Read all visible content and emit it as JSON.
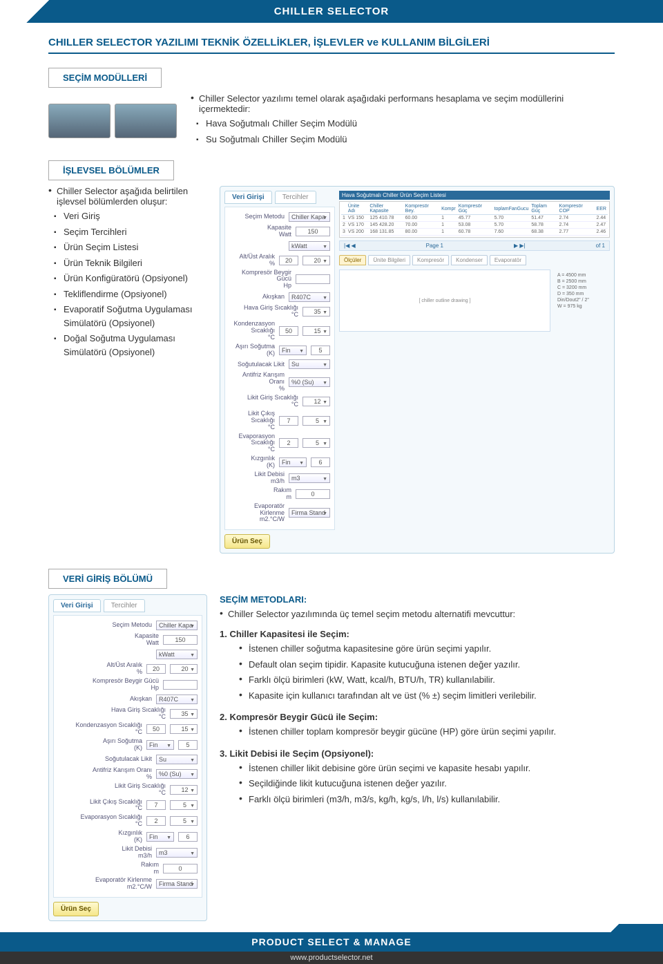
{
  "header": {
    "title": "CHILLER SELECTOR"
  },
  "subtitle": "CHILLER SELECTOR YAZILIMI TEKNİK ÖZELLİKLER, İŞLEVLER ve KULLANIM BİLGİLERİ",
  "section1": {
    "label": "SEÇİM MODÜLLERİ",
    "intro": "Chiller Selector yazılımı temel olarak aşağıdaki performans hesaplama ve seçim modüllerini içermektedir:",
    "items": [
      "Hava Soğutmalı Chiller Seçim Modülü",
      "Su Soğutmalı Chiller Seçim Modülü"
    ]
  },
  "section2": {
    "label": "İŞLEVSEL BÖLÜMLER",
    "intro": "Chiller Selector aşağıda belirtilen işlevsel bölümlerden oluşur:",
    "items": [
      "Veri Giriş",
      "Seçim Tercihleri",
      "Ürün Seçim Listesi",
      "Ürün Teknik Bilgileri",
      "Ürün Konfigüratörü (Opsiyonel)",
      "Tekliflendirme (Opsiyonel)",
      "Evaporatif Soğutma Uygulaması Simülatörü (Opsiyonel)",
      "Doğal Soğutma Uygulaması Simülatörü (Opsiyonel)"
    ]
  },
  "section3": {
    "label": "VERİ GİRİŞ BÖLÜMÜ"
  },
  "methods": {
    "title": "SEÇİM METODLARI:",
    "intro": "Chiller Selector yazılımında üç temel seçim metodu alternatifi mevcuttur:",
    "m1": {
      "title": "1. Chiller Kapasitesi ile Seçim:",
      "items": [
        "İstenen chiller soğutma kapasitesine göre ürün seçimi yapılır.",
        "Default olan seçim tipidir. Kapasite kutucuğuna istenen değer yazılır.",
        "Farklı ölçü birimleri (kW, Watt, kcal/h, BTU/h, TR) kullanılabilir.",
        "Kapasite için kullanıcı tarafından alt ve üst (% ±) seçim limitleri verilebilir."
      ]
    },
    "m2": {
      "title": "2. Kompresör Beygir Gücü ile Seçim:",
      "items": [
        "İstenen chiller toplam kompresör beygir gücüne (HP) göre ürün seçimi yapılır."
      ]
    },
    "m3": {
      "title": "3. Likit Debisi ile Seçim (Opsiyonel):",
      "items": [
        "İstenen chiller likit debisine göre ürün seçimi ve kapasite hesabı yapılır.",
        "Seçildiğinde likit kutucuğuna istenen değer yazılır.",
        "Farklı ölçü birimleri (m3/h, m3/s, kg/h, kg/s, l/h, l/s) kullanılabilir."
      ]
    }
  },
  "form": {
    "tab1": "Veri Girişi",
    "tab2": "Tercihler",
    "rows": [
      {
        "label": "Seçim Metodu",
        "type": "select",
        "val": "Chiller Kapa"
      },
      {
        "label": "Kapasite\nWatt",
        "type": "input",
        "val": "150"
      },
      {
        "label": "",
        "type": "select",
        "val": "kWatt"
      },
      {
        "label": "Alt/Üst Aralık\n%",
        "type": "dual",
        "val": "20",
        "val2": "20"
      },
      {
        "label": "Kompresör Beygir Gücü\nHp",
        "type": "input",
        "val": ""
      },
      {
        "label": "Akışkan",
        "type": "select",
        "val": "R407C"
      },
      {
        "label": "Hava Giriş Sıcaklığı\n°C",
        "type": "mini",
        "val": "35"
      },
      {
        "label": "Kondenzasyon Sıcaklığı\n°C",
        "type": "dual",
        "val": "50",
        "val2": "15"
      },
      {
        "label": "Aşırı Soğutma\n(K)",
        "type": "miniselect",
        "val": "Fin",
        "val2": "5"
      },
      {
        "label": "Soğutulacak Likit",
        "type": "select",
        "val": "Su"
      },
      {
        "label": "Antifriz Karışım Oranı\n%",
        "type": "select",
        "val": "%0 (Su)"
      },
      {
        "label": "Likit Giriş Sıcaklığı\n°C",
        "type": "mini",
        "val": "12"
      },
      {
        "label": "Likit Çıkış Sıcaklığı\n°C",
        "type": "dual",
        "val": "7",
        "val2": "5"
      },
      {
        "label": "Evaporasyon Sıcaklığı\n°C",
        "type": "dual",
        "val": "2",
        "val2": "5"
      },
      {
        "label": "Kızgınlık\n(K)",
        "type": "miniselect",
        "val": "Fin",
        "val2": "6"
      },
      {
        "label": "Likit Debisi\nm3/h",
        "type": "select",
        "val": "m3"
      },
      {
        "label": "Rakım\nm",
        "type": "input",
        "val": "0"
      },
      {
        "label": "Evaporatör Kirlenme\nm2.°C/W",
        "type": "select",
        "val": "Firma Stand"
      }
    ],
    "button": "Ürün Seç"
  },
  "resultTable": {
    "header": "Hava Soğutmalı Chiller Ürün Seçim Listesi",
    "cols": [
      "",
      "Ünite Adı",
      "Chiller Kapasite",
      "Kompresör Bey.",
      "Kompr",
      "Kompresör Güç",
      "toplamFanGucu",
      "Toplam Güç",
      "Kompresör COP",
      "EER"
    ],
    "rows": [
      [
        "1",
        "VS 150",
        "125 410.78",
        "60.00",
        "1",
        "45.77",
        "5.70",
        "51.47",
        "2.74",
        "2.44"
      ],
      [
        "2",
        "VS 170",
        "145 428.20",
        "70.00",
        "1",
        "53.08",
        "5.70",
        "58.78",
        "2.74",
        "2.47"
      ],
      [
        "3",
        "VS 200",
        "168 131.85",
        "80.00",
        "1",
        "60.78",
        "7.60",
        "68.38",
        "2.77",
        "2.46"
      ]
    ],
    "pager": {
      "left": "Page 1",
      "right": "of 1"
    },
    "tabs": [
      "Ölçüler",
      "Ünite Bilgileri",
      "Kompresör",
      "Kondenser",
      "Evaporatör"
    ],
    "specs": [
      "A = 4500 mm",
      "B = 2500 mm",
      "C = 3200 mm",
      "D = 350 mm",
      "Din/Dout2\" / 2\"",
      "W = 975 kg"
    ]
  },
  "footer": {
    "line1": "PRODUCT SELECT & MANAGE",
    "line2": "www.productselector.net"
  }
}
